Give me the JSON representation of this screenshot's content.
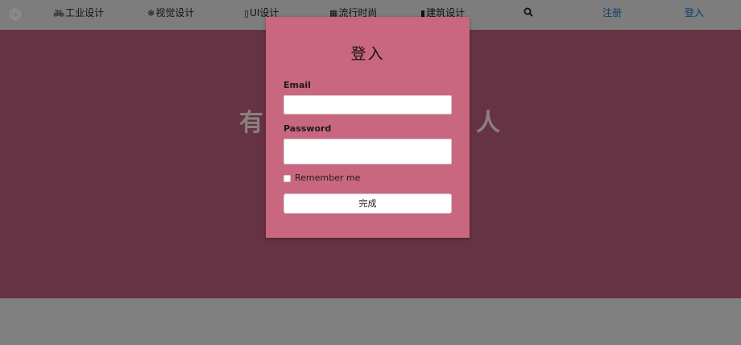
{
  "nav": {
    "logo_icon": "hexagon-logo-icon",
    "items": [
      {
        "icon": "bicycle-icon",
        "glyph": "🚲︎",
        "label": "工业设计"
      },
      {
        "icon": "snowflake-icon",
        "glyph": "❄",
        "label": "视觉设计"
      },
      {
        "icon": "mobile-icon",
        "glyph": "▯",
        "label": "UI设计"
      },
      {
        "icon": "film-icon",
        "glyph": "▦",
        "label": "流行时尚"
      },
      {
        "icon": "building-icon",
        "glyph": "▮",
        "label": "建筑设计"
      }
    ],
    "search_icon": "search-icon",
    "register_label": "注册",
    "login_label": "登入"
  },
  "hero": {
    "title_left": "有",
    "title_right": "人"
  },
  "login_modal": {
    "title": "登入",
    "email_label": "Email",
    "email_value": "",
    "password_label": "Password",
    "password_value": "",
    "remember_label": "Remember me",
    "remember_checked": false,
    "submit_label": "完成"
  },
  "colors": {
    "overlay_gray": "#808080",
    "hero": "#663344",
    "modal": "#c96680",
    "link": "#0d3f6e"
  }
}
